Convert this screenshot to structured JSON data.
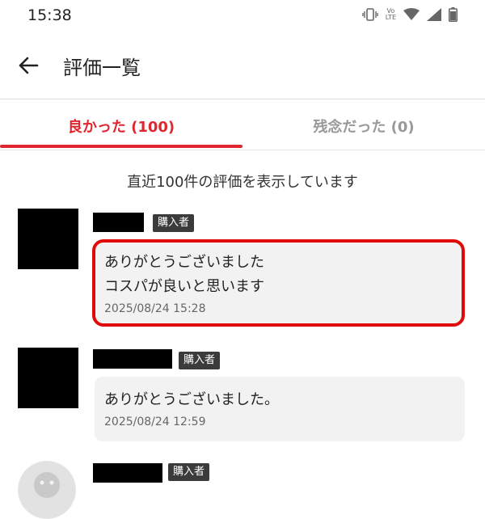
{
  "status_bar": {
    "time": "15:38",
    "volte_line1": "Vo",
    "volte_line2": "LTE"
  },
  "app_bar": {
    "title": "評価一覧"
  },
  "tabs": [
    {
      "label": "良かった (100)",
      "selected": true
    },
    {
      "label": "残念だった (0)",
      "selected": false
    }
  ],
  "notice": "直近100件の評価を表示しています",
  "reviews": [
    {
      "badge": "購入者",
      "lines": [
        "ありがとうございました",
        "コスパが良いと思います"
      ],
      "date": "2025/08/24 15:28"
    },
    {
      "badge": "購入者",
      "lines": [
        "ありがとうございました。"
      ],
      "date": "2025/08/24 12:59"
    },
    {
      "badge": "購入者"
    }
  ],
  "colors": {
    "accent": "#e0262f",
    "highlight": "#e00a0a",
    "badge_bg": "#3b3b3b",
    "bubble_bg": "#f2f2f2"
  }
}
